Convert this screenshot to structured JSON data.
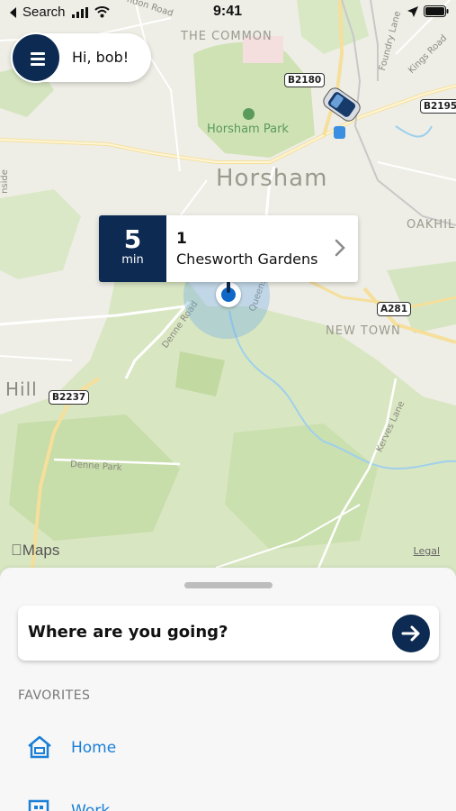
{
  "status_bar": {
    "back_label": "Search",
    "time": "9:41"
  },
  "header": {
    "greeting": "Hi, bob!"
  },
  "map": {
    "places": {
      "the_common": "THE COMMON",
      "horsham_park": "Horsham Park",
      "horsham": "Horsham",
      "oakhill": "OAKHIL",
      "new_town": "NEW TOWN",
      "hill": "Hill"
    },
    "roads": {
      "b2180": "B2180",
      "b2195": "B2195",
      "a281": "A281",
      "b2237": "B2237",
      "denne_road": "Denne Road",
      "queens": "Queens",
      "denne_park": "Denne Park",
      "kerves_lane": "Kerves Lane",
      "foundry_lane": "Foundry Lane",
      "kings_road": "Kings Road",
      "london_road": "ndon Road",
      "side_road": "nside"
    },
    "attribution": {
      "logo": "Maps",
      "legal": "Legal"
    }
  },
  "eta_card": {
    "minutes": "5",
    "unit": "min",
    "address_number": "1",
    "address_street": "Chesworth Gardens"
  },
  "sheet": {
    "search_placeholder": "Where are you going?",
    "favorites_header": "FAVORITES",
    "favorites": [
      {
        "label": "Home",
        "icon": "home-icon"
      },
      {
        "label": "Work",
        "icon": "work-icon"
      }
    ]
  },
  "colors": {
    "navy": "#0d2b52",
    "link_blue": "#1a7fd6",
    "park_green": "#c9dfb0",
    "map_base": "#eeeee6"
  }
}
